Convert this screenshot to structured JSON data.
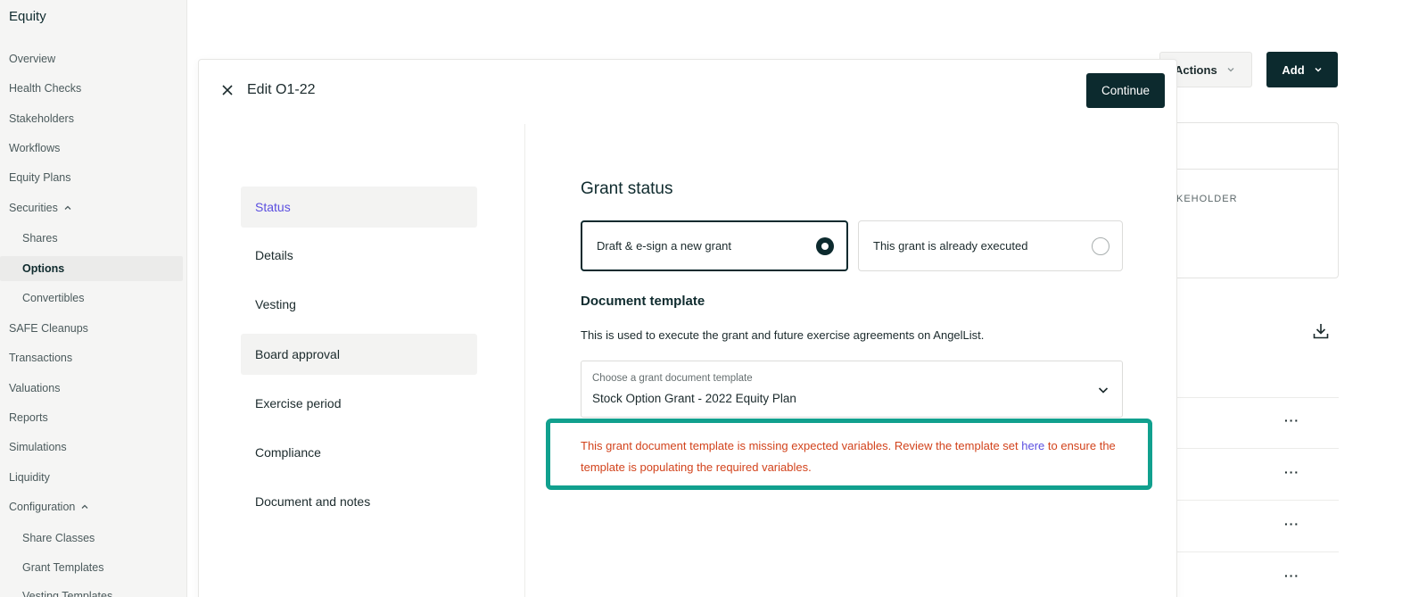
{
  "sidebar": {
    "brand": "Equity",
    "items": {
      "overview": "Overview",
      "health_checks": "Health Checks",
      "stakeholders": "Stakeholders",
      "workflows": "Workflows",
      "equity_plans": "Equity Plans",
      "securities": "Securities",
      "shares": "Shares",
      "options": "Options",
      "convertibles": "Convertibles",
      "safe_cleanups": "SAFE Cleanups",
      "transactions": "Transactions",
      "valuations": "Valuations",
      "reports": "Reports",
      "simulations": "Simulations",
      "liquidity": "Liquidity",
      "configuration": "Configuration",
      "share_classes": "Share Classes",
      "grant_templates": "Grant Templates",
      "vesting_templates": "Vesting Templates"
    }
  },
  "background": {
    "actions_label": "Actions",
    "add_label": "Add",
    "column_header": "KEHOLDER",
    "row_menu": "···"
  },
  "modal": {
    "title": "Edit O1-22",
    "continue_label": "Continue",
    "steps": {
      "status": "Status",
      "details": "Details",
      "vesting": "Vesting",
      "board_approval": "Board approval",
      "exercise_period": "Exercise period",
      "compliance": "Compliance",
      "document_notes": "Document and notes"
    },
    "grant_status": {
      "title": "Grant status",
      "option_draft": "Draft & e-sign a new grant",
      "option_executed": "This grant is already executed"
    },
    "document_template": {
      "title": "Document template",
      "description": "This is used to execute the grant and future exercise agreements on AngelList.",
      "select_label": "Choose a grant document template",
      "select_value": "Stock Option Grant - 2022 Equity Plan"
    },
    "warning": {
      "text_before": "This grant document template is missing expected variables. Review the template set ",
      "link": "here",
      "text_after": " to ensure the template is populating the required variables."
    }
  },
  "colors": {
    "primary_dark": "#0c2a2e",
    "accent_purple": "#5b4fe0",
    "warning_red": "#d2431c",
    "highlight_teal": "#11a08e"
  }
}
